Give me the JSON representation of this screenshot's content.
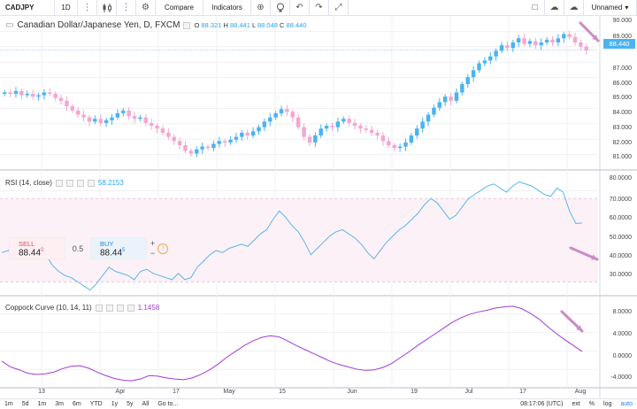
{
  "toolbar": {
    "symbol": "CADJPY",
    "interval": "1D",
    "compare": "Compare",
    "indicators": "Indicators",
    "layout_name": "Unnamed",
    "icons": [
      "more-icon",
      "candles-icon",
      "more-icon",
      "gear-icon",
      "add-alert-icon",
      "lightbulb-icon",
      "undo-icon",
      "redo-icon",
      "fullscreen-icon",
      "square-icon",
      "cloud-icon",
      "cloud-save-icon",
      "chevron-down-icon"
    ]
  },
  "main": {
    "title": "Canadian Dollar/Japanese Yen, D, FXCM",
    "ohlc": {
      "o_label": "O",
      "o": "88.321",
      "h_label": "H",
      "h": "88.441",
      "l_label": "L",
      "l": "88.048",
      "c_label": "C",
      "c": "88.440"
    },
    "last_price": "88.440",
    "price_axis": [
      "90.000",
      "89.000",
      "87.000",
      "86.000",
      "85.000",
      "84.000",
      "83.000",
      "82.000",
      "81.000"
    ],
    "up_color": "#4bb3f2",
    "down_color": "#f4a6cf"
  },
  "rsi": {
    "label": "RSI (14, close)",
    "value": "58.2153",
    "axis": [
      "80.0000",
      "70.0000",
      "60.0000",
      "50.0000",
      "40.0000",
      "30.0000"
    ]
  },
  "coppock": {
    "label": "Coppock Curve (10, 14, 11)",
    "value": "1.1458",
    "axis": [
      "8.0000",
      "4.0000",
      "0.0000",
      "-4.0000"
    ]
  },
  "trade": {
    "sell_label": "SELL",
    "sell_price": "88.44",
    "sell_sup": "0",
    "spread": "0.5",
    "buy_label": "BUY",
    "buy_price": "88.44",
    "buy_sup": "5",
    "plus": "+",
    "minus": "−",
    "warn": "!"
  },
  "x_axis": [
    "13",
    "Apr",
    "17",
    "May",
    "15",
    "Jun",
    "19",
    "Jul",
    "17",
    "Aug"
  ],
  "bottombar": {
    "ranges": [
      "1m",
      "5d",
      "1m",
      "3m",
      "6m",
      "YTD",
      "1y",
      "5y",
      "All"
    ],
    "goto": "Go to...",
    "time": "08:17:06 (UTC)",
    "ext": "ext",
    "pct": "%",
    "log": "log",
    "auto": "auto"
  },
  "chart_data": [
    {
      "type": "candlestick",
      "title": "Canadian Dollar/Japanese Yen, D, FXCM",
      "ylim": [
        80.2,
        90.4
      ],
      "closes": [
        85.4,
        85.3,
        85.5,
        85.2,
        85.3,
        85.1,
        85.2,
        85.4,
        85.3,
        85.0,
        84.8,
        84.4,
        84.1,
        83.8,
        83.6,
        83.3,
        83.5,
        83.2,
        83.4,
        83.6,
        83.9,
        84.1,
        83.7,
        83.5,
        83.6,
        83.2,
        83.0,
        82.8,
        82.5,
        82.2,
        81.9,
        81.6,
        81.2,
        81.0,
        81.3,
        81.5,
        81.4,
        81.7,
        81.9,
        81.8,
        82.0,
        82.2,
        82.5,
        82.3,
        82.6,
        82.9,
        83.3,
        83.6,
        83.9,
        84.2,
        84.0,
        83.6,
        82.9,
        82.2,
        81.8,
        82.3,
        82.8,
        83.0,
        82.9,
        83.3,
        83.5,
        83.2,
        83.0,
        82.8,
        82.7,
        82.5,
        82.3,
        81.9,
        81.6,
        81.4,
        81.5,
        81.8,
        82.3,
        82.8,
        83.3,
        83.8,
        84.3,
        84.7,
        85.1,
        84.8,
        85.4,
        86.0,
        86.5,
        87.0,
        87.5,
        87.7,
        88.0,
        88.4,
        88.8,
        88.6,
        89.0,
        89.3,
        88.9,
        89.1,
        88.8,
        89.0,
        89.2,
        89.0,
        89.3,
        89.6,
        89.4,
        89.0,
        88.7,
        88.44
      ]
    },
    {
      "type": "line",
      "title": "RSI (14, close)",
      "ylim": [
        25,
        82
      ],
      "values": [
        44,
        45,
        43,
        47,
        46,
        44,
        42,
        43,
        38,
        35,
        33,
        32,
        30,
        28,
        26,
        29,
        33,
        37,
        35,
        34,
        33,
        31,
        35,
        36,
        34,
        33,
        32,
        31,
        34,
        31,
        32,
        37,
        40,
        43,
        45,
        44,
        46,
        47,
        48,
        47,
        50,
        53,
        55,
        60,
        64,
        61,
        57,
        54,
        49,
        43,
        46,
        49,
        52,
        54,
        55,
        53,
        51,
        48,
        44,
        41,
        45,
        49,
        52,
        55,
        57,
        60,
        63,
        67,
        70,
        68,
        64,
        60,
        62,
        66,
        70,
        72,
        74,
        76,
        77,
        75,
        73,
        76,
        78,
        77,
        76,
        74,
        72,
        71,
        75,
        73,
        64,
        58,
        58.2153
      ]
    },
    {
      "type": "line",
      "title": "Coppock Curve (10, 14, 11)",
      "ylim": [
        -4.8,
        9.6
      ],
      "values": [
        -0.5,
        -1.5,
        -2.0,
        -2.6,
        -2.8,
        -2.7,
        -2.4,
        -1.8,
        -1.4,
        -1.3,
        -1.7,
        -2.4,
        -3.0,
        -3.5,
        -3.8,
        -3.9,
        -3.6,
        -3.0,
        -3.1,
        -3.4,
        -3.6,
        -3.7,
        -3.4,
        -2.8,
        -2.0,
        -1.0,
        0.2,
        1.2,
        2.2,
        3.0,
        3.6,
        3.9,
        3.7,
        3.0,
        2.2,
        1.5,
        0.8,
        0.1,
        -0.6,
        -1.1,
        -1.5,
        -1.9,
        -2.1,
        -2.0,
        -1.6,
        -0.9,
        0.1,
        1.1,
        2.2,
        3.2,
        4.2,
        5.2,
        6.2,
        7.0,
        7.6,
        8.0,
        8.3,
        8.7,
        8.9,
        9.0,
        8.6,
        7.8,
        6.8,
        5.5,
        4.3,
        3.2,
        2.2,
        1.1458
      ]
    }
  ]
}
